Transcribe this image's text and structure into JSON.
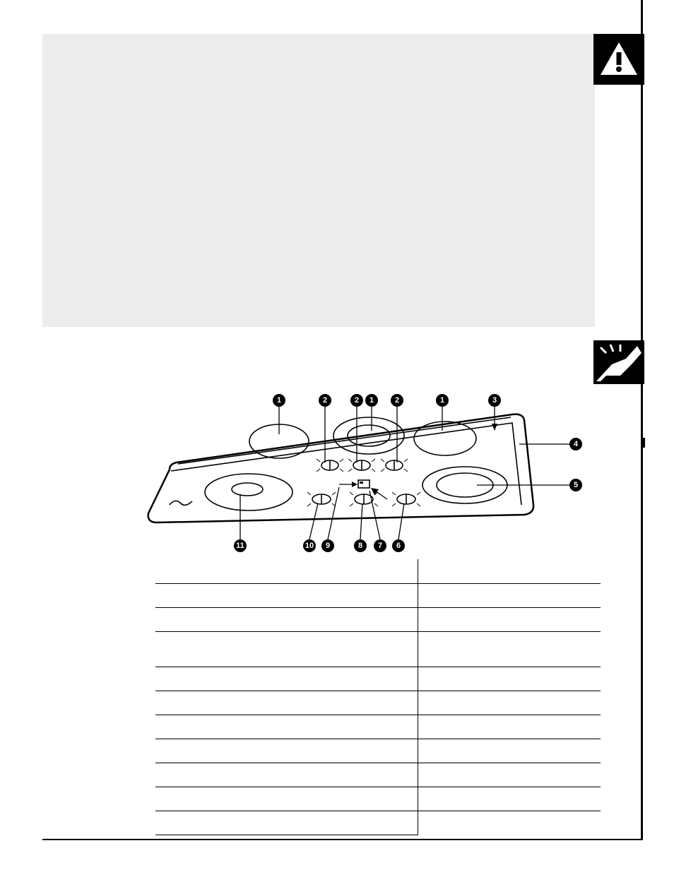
{
  "callouts_top": [
    "1",
    "2",
    "2",
    "1",
    "2",
    "1",
    "3"
  ],
  "callout_right_1": "4",
  "callout_right_2": "5",
  "callouts_bottom": [
    "11",
    "10",
    "9",
    "8",
    "7",
    "6"
  ],
  "table": {
    "rows": [
      {
        "left": "",
        "right": ""
      },
      {
        "left": "",
        "right": ""
      },
      {
        "left": "",
        "right": ""
      },
      {
        "left": "",
        "right": ""
      },
      {
        "left": "",
        "right": ""
      },
      {
        "left": "",
        "right": ""
      },
      {
        "left": "",
        "right": ""
      },
      {
        "left": "",
        "right": ""
      },
      {
        "left": "",
        "right": ""
      },
      {
        "left": "",
        "right": ""
      },
      {
        "left": "",
        "right": ""
      }
    ]
  }
}
